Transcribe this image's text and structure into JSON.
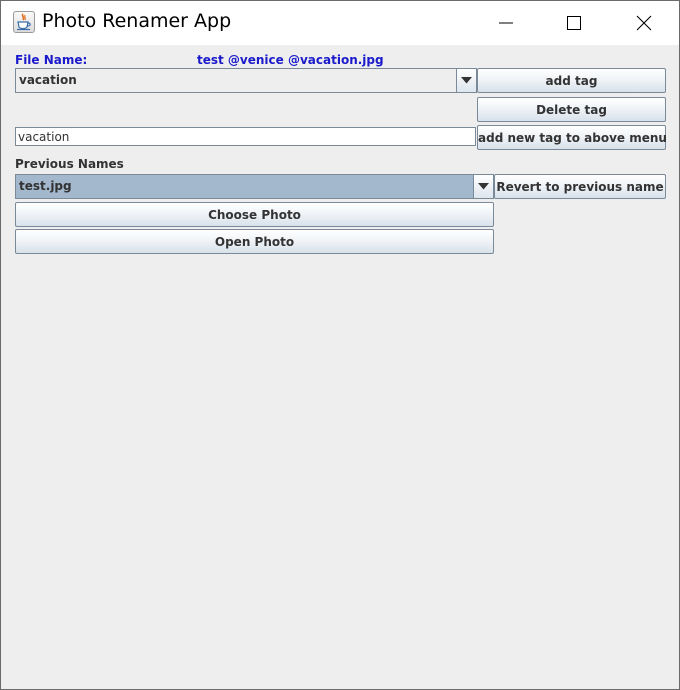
{
  "window": {
    "title": "Photo Renamer App",
    "icon": "java-coffee-cup-icon",
    "controls": [
      "minimize-icon",
      "maximize-icon",
      "close-icon"
    ]
  },
  "file_name": {
    "label": "File Name:",
    "value": "test @venice @vacation.jpg"
  },
  "tags": {
    "selected_tag": "vacation",
    "add_tag_label": "add tag",
    "delete_tag_label": "Delete tag",
    "new_tag_value": "vacation",
    "add_new_tag_label": "add new tag to above menu"
  },
  "previous_names": {
    "label": "Previous Names",
    "selected_name": "test.jpg",
    "revert_label": "Revert to previous name"
  },
  "actions": {
    "choose_photo_label": "Choose Photo",
    "open_photo_label": "Open Photo"
  },
  "colors": {
    "label_blue": "#1a1acc",
    "selected_combo": "#a3b8cc",
    "window_bg": "#eeeeee"
  }
}
